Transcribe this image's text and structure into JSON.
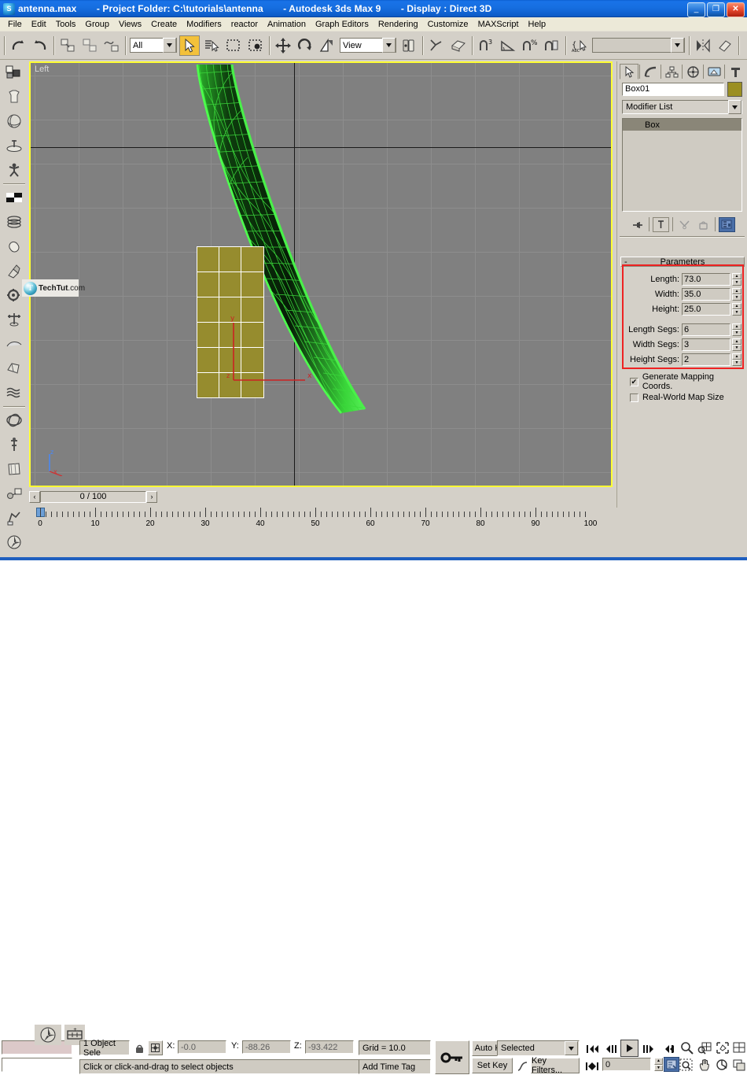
{
  "window": {
    "app_icon": "3dsmax-icon",
    "title_file": "antenna.max",
    "title_project": "- Project Folder: C:\\tutorials\\antenna",
    "title_app": "- Autodesk 3ds Max 9",
    "title_display": "- Display : Direct 3D",
    "minimize": "_",
    "restore": "❐",
    "close": "✕",
    "titlebar_color": "#1973e8"
  },
  "menu": {
    "items": [
      "File",
      "Edit",
      "Tools",
      "Group",
      "Views",
      "Create",
      "Modifiers",
      "reactor",
      "Animation",
      "Graph Editors",
      "Rendering",
      "Customize",
      "MAXScript",
      "Help"
    ]
  },
  "toolbar": {
    "undo": "undo-arrow-icon",
    "redo": "redo-arrow-icon",
    "select_link": "select-and-link-icon",
    "unlink": "unlink-selection-icon",
    "bind_space_warp": "bind-to-space-warp-icon",
    "selection_filter_value": "All",
    "select_object": "select-object-arrow-icon",
    "select_by_name": "select-by-name-icon",
    "select_region": "rectangular-selection-region-icon",
    "window_crossing": "window-crossing-icon",
    "select_move": "select-and-move-icon",
    "select_rotate": "select-and-rotate-icon",
    "select_scale": "select-and-scale-icon",
    "reference_coord_value": "View",
    "use_center": "use-pivot-point-center-icon",
    "select_manipulate": "select-and-manipulate-icon",
    "snap_toggle": "snaps-toggle-icon",
    "angle_snap": "angle-snap-toggle-icon",
    "percent_snap": "percent-snap-toggle-icon",
    "spinner_snap": "spinner-snap-toggle-icon",
    "named_selection": "named-selection-sets-icon",
    "named_set_value": "",
    "mirror": "mirror-icon",
    "align": "align-icon"
  },
  "left_toolbar": {
    "items": [
      {
        "name": "standard-primitives-icon"
      },
      {
        "name": "garment-maker-icon"
      },
      {
        "name": "sphere-object-icon"
      },
      {
        "name": "plane-helper-icon"
      },
      {
        "name": "biped-figure-icon"
      },
      {
        "name": "checker-material-icon"
      },
      {
        "name": "coil-spring-icon"
      },
      {
        "name": "capsule-icon"
      },
      {
        "name": "magnet-icon"
      },
      {
        "name": "gear-icon"
      },
      {
        "name": "tree-icon"
      },
      {
        "name": "bone-tools-icon"
      },
      {
        "name": "rigid-body-icon"
      },
      {
        "name": "cloth-icon"
      },
      {
        "name": "waves-icon"
      },
      {
        "name": "torus-knot-icon"
      },
      {
        "name": "skeleton-icon"
      },
      {
        "name": "soft-body-icon"
      },
      {
        "name": "constraint-icon"
      },
      {
        "name": "spring-dynamics-icon"
      },
      {
        "name": "reactor-icon"
      }
    ]
  },
  "viewport": {
    "label": "Left",
    "axis_labels": {
      "z": "z",
      "x": "x",
      "y": "y"
    },
    "background_color": "#808080",
    "grid_color": "#8d8d8d",
    "active_border_color": "#ffff33",
    "selected_object_color": "#968c2e",
    "selected_wire_color": "#ffffff",
    "other_object_color": "#33cc33",
    "gizmo_color": "#cc2222"
  },
  "watermark": {
    "brand": "TechTut",
    "suffix": ".com",
    "orb": "T"
  },
  "command_panel": {
    "tabs": [
      {
        "name": "create-tab",
        "icon": "arrow-cursor-icon",
        "selected": true
      },
      {
        "name": "modify-tab",
        "icon": "bend-curve-icon",
        "selected": false
      },
      {
        "name": "hierarchy-tab",
        "icon": "hierarchy-tree-icon",
        "selected": false
      },
      {
        "name": "motion-tab",
        "icon": "wheel-icon",
        "selected": false
      },
      {
        "name": "display-tab",
        "icon": "monitor-icon",
        "selected": false
      },
      {
        "name": "utilities-tab",
        "icon": "hammer-icon",
        "selected": false
      }
    ],
    "object_name": "Box01",
    "object_color": "#9b8f22",
    "modifier_list_label": "Modifier List",
    "stack": [
      "Box"
    ],
    "stack_buttons": [
      {
        "name": "pin-stack-icon"
      },
      {
        "name": "show-end-result-icon"
      },
      {
        "name": "make-unique-icon"
      },
      {
        "name": "remove-modifier-icon"
      },
      {
        "name": "configure-modifier-sets-icon"
      }
    ],
    "rollup": {
      "title": "Parameters",
      "collapse_glyph": "-",
      "fields": [
        {
          "label": "Length:",
          "value": "73.0"
        },
        {
          "label": "Width:",
          "value": "35.0"
        },
        {
          "label": "Height:",
          "value": "25.0"
        },
        {
          "label": "Length Segs:",
          "value": "6"
        },
        {
          "label": "Width Segs:",
          "value": "3"
        },
        {
          "label": "Height Segs:",
          "value": "2"
        }
      ],
      "checkboxes": [
        {
          "label": "Generate Mapping Coords.",
          "checked": true,
          "mark": "✔"
        },
        {
          "label": "Real-World Map Size",
          "checked": false,
          "mark": ""
        }
      ]
    },
    "highlight_color": "#ee2222"
  },
  "trackbar": {
    "prev_glyph": "‹",
    "next_glyph": "›",
    "frame_readout": "0 / 100"
  },
  "ruler": {
    "labels": [
      "10",
      "20",
      "30",
      "40",
      "50",
      "60",
      "70",
      "80",
      "90",
      "100"
    ],
    "start_label": "0"
  },
  "status": {
    "maxscript_prompt_icon": "maxscript-mini-listener",
    "object_count": "1 Object Sele",
    "lock_icon": "lock-selection-icon",
    "absolute_mode_icon": "absolute-relative-transform-icon",
    "x_label": "X:",
    "x_value": "-0.0",
    "y_label": "Y:",
    "y_value": "-88.26",
    "z_label": "Z:",
    "z_value": "-93.422",
    "grid_text": "Grid = 10.0",
    "prompt_text": "Click or click-and-drag to select objects",
    "add_time_tag": "Add Time Tag",
    "key_mode_icon": "key-mode-toggle-icon",
    "auto_key": "Auto Key",
    "set_key": "Set Key",
    "key_filter_value": "Selected",
    "key_filters_button": "Key Filters...",
    "set_key_arrow_icon": "set-key-curve-icon",
    "current_frame": "0",
    "playback": [
      {
        "name": "go-to-start-button",
        "glyph": "|◀◀"
      },
      {
        "name": "previous-frame-button",
        "glyph": "◀|▮"
      },
      {
        "name": "play-animation-button",
        "glyph": "▶"
      },
      {
        "name": "next-frame-button",
        "glyph": "▮|▶"
      },
      {
        "name": "go-to-end-button",
        "glyph": "▶▶|"
      }
    ],
    "key_nav_glyph": "|◀▶|",
    "time_config_icon": "time-configuration-icon",
    "nav": [
      {
        "name": "zoom-button",
        "icon": "magnifier-icon"
      },
      {
        "name": "zoom-all-button",
        "icon": "zoom-all-icon"
      },
      {
        "name": "zoom-extents-button",
        "icon": "zoom-extents-icon"
      },
      {
        "name": "zoom-extents-all-button",
        "icon": "zoom-extents-all-icon"
      },
      {
        "name": "region-zoom-button",
        "icon": "region-zoom-icon"
      },
      {
        "name": "pan-button",
        "icon": "hand-pan-icon"
      },
      {
        "name": "arc-rotate-button",
        "icon": "arc-rotate-icon"
      },
      {
        "name": "maximize-viewport-button",
        "icon": "maximize-viewport-icon"
      }
    ]
  }
}
